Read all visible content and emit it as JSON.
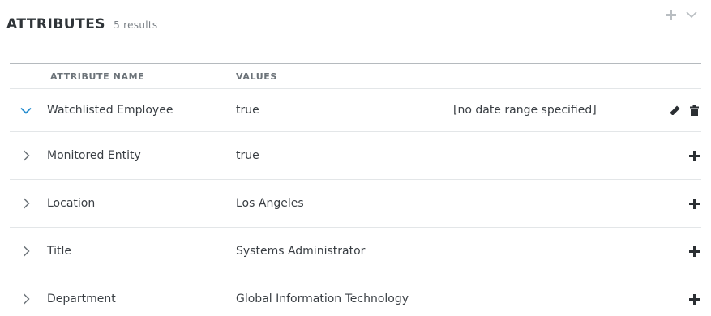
{
  "header": {
    "title": "ATTRIBUTES",
    "count": "5 results",
    "add_icon": "plus-icon",
    "collapse_icon": "chevron-down-icon"
  },
  "table": {
    "columns": {
      "name": "ATTRIBUTE NAME",
      "values": "VALUES"
    },
    "rows": [
      {
        "name": "Watchlisted Employee",
        "value": "true",
        "date_range": "[no date range specified]",
        "expanded": true,
        "actions": [
          "pencil-icon",
          "trash-icon"
        ]
      },
      {
        "name": "Monitored Entity",
        "value": "true",
        "expanded": false,
        "actions": [
          "plus-icon"
        ]
      },
      {
        "name": "Location",
        "value": "Los Angeles",
        "expanded": false,
        "actions": [
          "plus-icon"
        ]
      },
      {
        "name": "Title",
        "value": "Systems Administrator",
        "expanded": false,
        "actions": [
          "plus-icon"
        ]
      },
      {
        "name": "Department",
        "value": "Global Information Technology",
        "expanded": false,
        "actions": [
          "plus-icon"
        ]
      }
    ]
  },
  "colors": {
    "accent": "#2a8fd0",
    "icon_dark": "#2b2f33",
    "icon_muted": "#b9bec2",
    "border": "#b5babe",
    "row_border": "#e3e6e8"
  }
}
